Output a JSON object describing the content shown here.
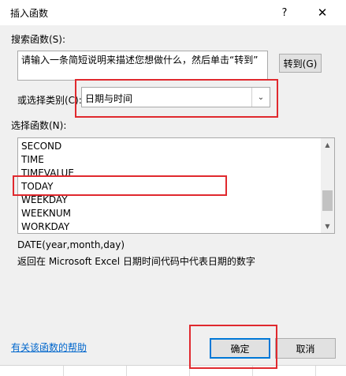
{
  "dialog": {
    "title": "插入函数",
    "help_glyph": "?",
    "close_glyph": "✕"
  },
  "search": {
    "label": "搜索函数(S):",
    "value": "请输入一条简短说明来描述您想做什么，然后单击“转到”",
    "go_label": "转到(G)"
  },
  "category": {
    "label": "或选择类别(C):",
    "selected": "日期与时间",
    "arrow_glyph": "⌄"
  },
  "functions": {
    "label": "选择函数(N):",
    "items": [
      "SECOND",
      "TIME",
      "TIMEVALUE",
      "TODAY",
      "WEEKDAY",
      "WEEKNUM",
      "WORKDAY"
    ],
    "highlighted": "TODAY"
  },
  "scrollbar": {
    "up_glyph": "▲",
    "down_glyph": "▼"
  },
  "details": {
    "syntax": "DATE(year,month,day)",
    "description": "返回在 Microsoft Excel 日期时间代码中代表日期的数字"
  },
  "footer": {
    "help_link": "有关该函数的帮助",
    "ok_label": "确定",
    "cancel_label": "取消"
  },
  "colors": {
    "annotation": "#e0292e",
    "link": "#0066cc",
    "focus": "#0078d7"
  }
}
